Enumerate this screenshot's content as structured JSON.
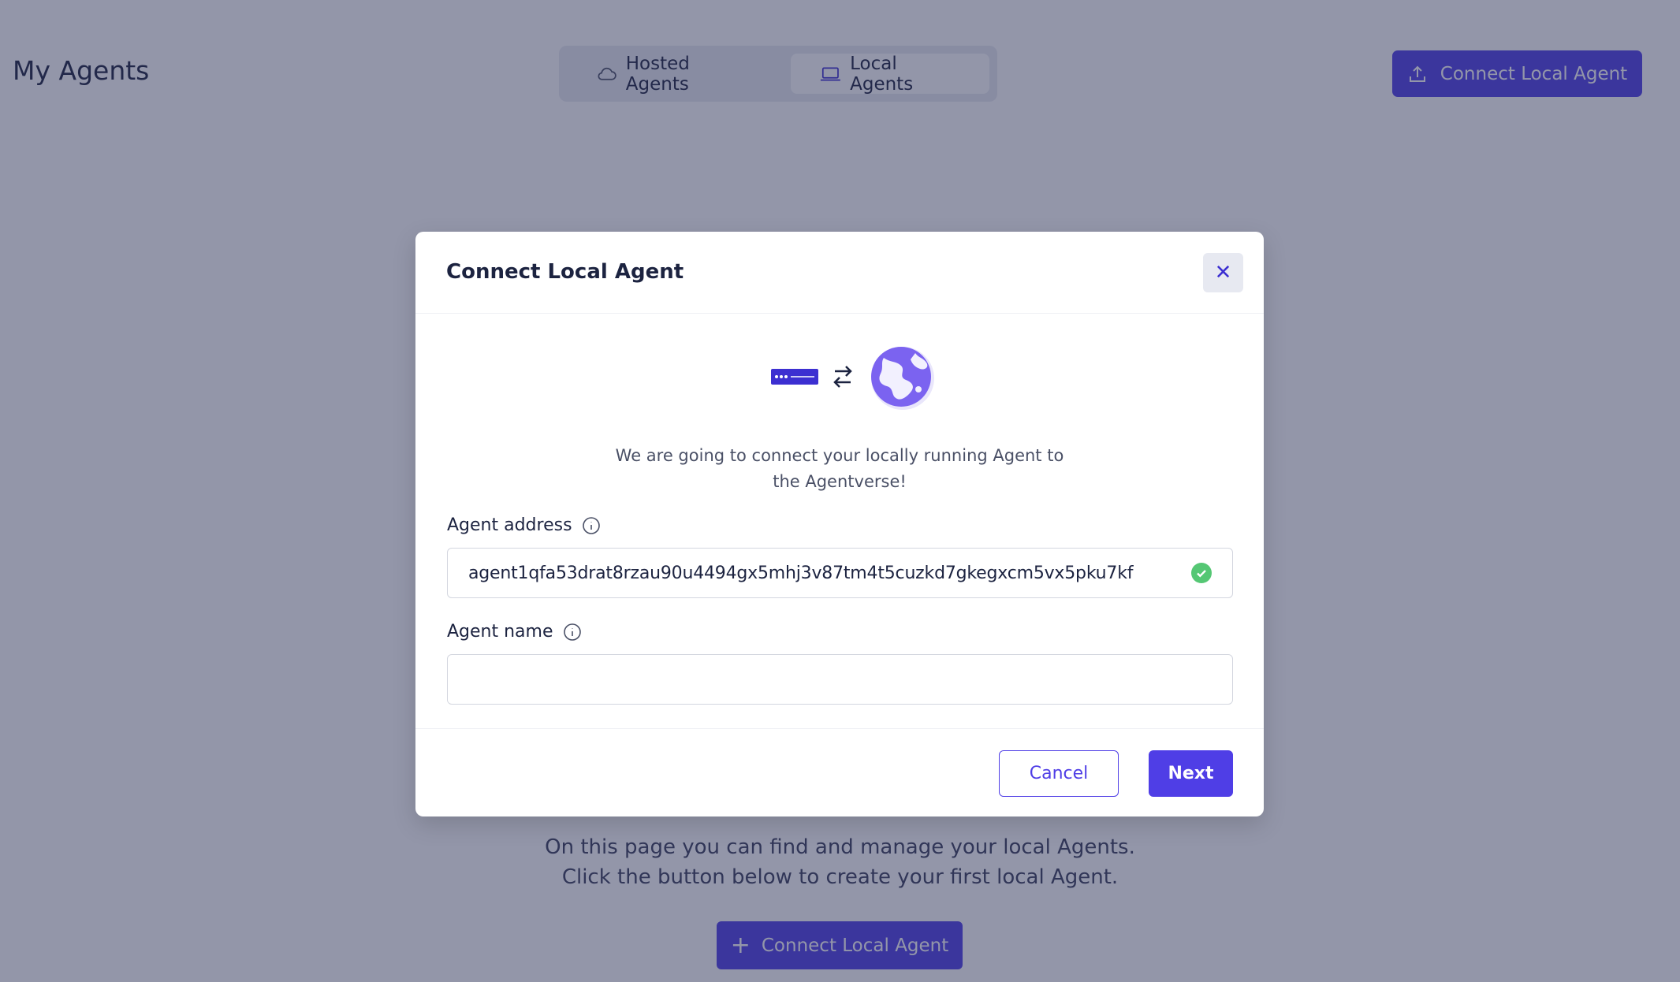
{
  "page": {
    "title": "My Agents",
    "header_button_label": "Connect Local Agent",
    "tabs": [
      {
        "label": "Hosted Agents",
        "icon": "cloud-icon",
        "active": false
      },
      {
        "label": "Local Agents",
        "icon": "laptop-icon",
        "active": true
      }
    ],
    "empty_state": {
      "line1": "On this page you can find and manage your local Agents.",
      "line2": "Click the button below to create your first local Agent.",
      "button_label": "Connect Local Agent"
    }
  },
  "modal": {
    "title": "Connect Local Agent",
    "description_line1": "We are going to connect your locally running Agent to",
    "description_line2": "the Agentverse!",
    "address": {
      "label": "Agent address",
      "value": "agent1qfa53drat8rzau90u4494gx5mhj3v87tm4t5cuzkd7gkegxcm5vx5pku7kf",
      "valid": true
    },
    "name": {
      "label": "Agent name",
      "value": "",
      "placeholder": ""
    },
    "cancel_label": "Cancel",
    "next_label": "Next"
  },
  "colors": {
    "accent": "#4f3ee6",
    "overlay": "#282e54",
    "success": "#55c774",
    "text_dark": "#1c2340"
  }
}
